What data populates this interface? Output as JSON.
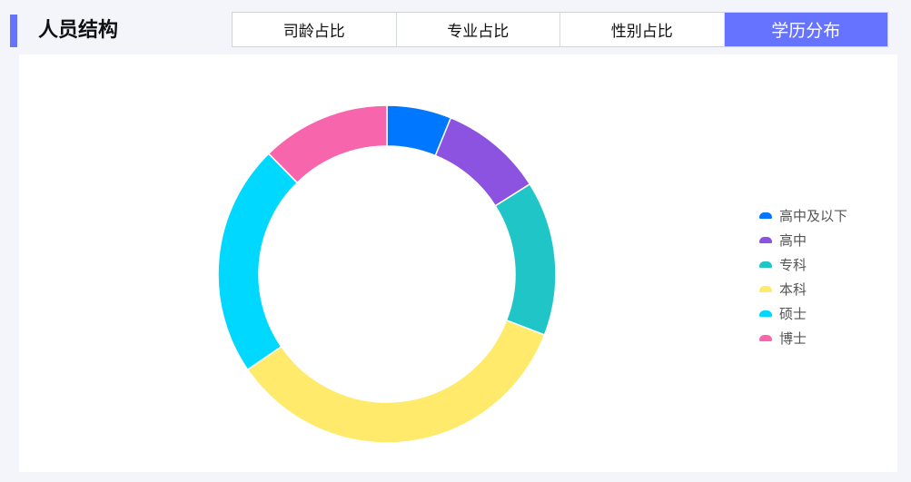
{
  "header": {
    "title": "人员结构",
    "tabs": [
      {
        "label": "司龄占比"
      },
      {
        "label": "专业占比"
      },
      {
        "label": "性别占比"
      },
      {
        "label": "学历分布"
      }
    ],
    "active_tab": 3
  },
  "chart_data": {
    "type": "pie",
    "variant": "donut",
    "title": "学历分布",
    "categories": [
      "高中及以下",
      "高中",
      "专科",
      "本科",
      "硕士",
      "博士"
    ],
    "values": [
      5,
      8,
      12,
      28,
      18,
      10
    ],
    "colors": [
      "#0077ff",
      "#8c52e0",
      "#20c5c8",
      "#ffea6b",
      "#00d8ff",
      "#f766ac"
    ],
    "legend_position": "right"
  }
}
